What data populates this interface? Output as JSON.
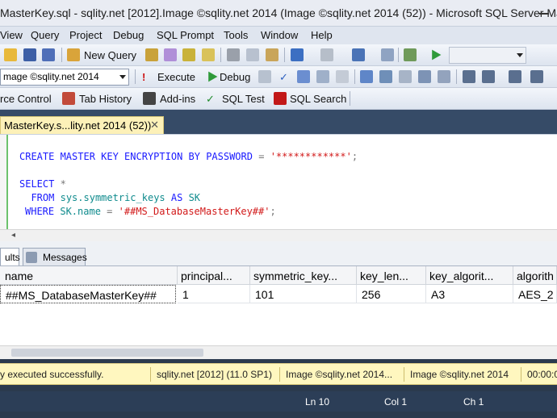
{
  "window": {
    "title": "MasterKey.sql - sqlity.net [2012].Image ©sqlity.net 2014 (Image ©sqlity.net 2014 (52)) - Microsoft SQL Server Mana..."
  },
  "menu": [
    "View",
    "Query",
    "Project",
    "Debug",
    "SQL Prompt",
    "Tools",
    "Window",
    "Help"
  ],
  "toolbar1": {
    "new_query_label": "New Query"
  },
  "toolbar2": {
    "database_value": "mage ©sqlity.net 2014",
    "execute_label": "Execute",
    "debug_label": "Debug"
  },
  "toolbar3": {
    "items": [
      "rce Control",
      "Tab History",
      "Add-ins",
      "SQL Test",
      "SQL Search"
    ]
  },
  "doc_tab": {
    "label": "MasterKey.s...lity.net 2014 (52))",
    "close_glyph": "✕"
  },
  "editor": {
    "line1": {
      "kw": "CREATE MASTER KEY ENCRYPTION BY PASSWORD",
      "op": "=",
      "str": "'************'",
      "end": ";"
    },
    "line2": {
      "kw": "SELECT",
      "rest": "*"
    },
    "line3": {
      "kw": "FROM",
      "obj": "sys.symmetric_keys",
      "as": "AS",
      "alias": "SK"
    },
    "line4": {
      "kw": "WHERE",
      "col": "SK.name",
      "op": "=",
      "str": "'##MS_DatabaseMasterKey##'",
      "end": ";"
    }
  },
  "results": {
    "tabs": [
      "ults",
      "Messages"
    ],
    "columns": [
      "name",
      "principal...",
      "symmetric_key...",
      "key_len...",
      "key_algorit...",
      "algorith"
    ],
    "rows": [
      [
        "##MS_DatabaseMasterKey##",
        "1",
        "101",
        "256",
        "A3",
        "AES_2"
      ]
    ]
  },
  "query_status": {
    "message": "y executed successfully.",
    "server": "sqlity.net [2012] (11.0 SP1)",
    "login": "Image ©sqlity.net 2014...",
    "database": "Image ©sqlity.net 2014",
    "elapsed": "00:00:0"
  },
  "statusbar": {
    "ln": "Ln 10",
    "col": "Col 1",
    "ch": "Ch 1"
  },
  "colors": {
    "accent": "#2c3e57",
    "tab_yellow": "#fdf1b8",
    "keyword": "#1a1aff",
    "string": "#d21a1a",
    "identifier": "#0f8b8d"
  }
}
